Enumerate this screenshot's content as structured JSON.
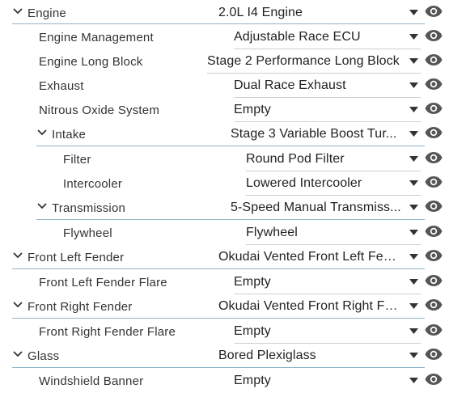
{
  "rows": [
    {
      "label": "Engine",
      "value": "2.0L I4 Engine",
      "expandable": true
    },
    {
      "label": "Engine Management",
      "value": "Adjustable Race ECU",
      "expandable": false
    },
    {
      "label": "Engine Long Block",
      "value": "Stage 2 Performance Long Block",
      "expandable": false
    },
    {
      "label": "Exhaust",
      "value": "Dual Race Exhaust",
      "expandable": false
    },
    {
      "label": "Nitrous Oxide System",
      "value": "Empty",
      "expandable": false
    },
    {
      "label": "Intake",
      "value": "Stage 3 Variable Boost Tur...",
      "expandable": true
    },
    {
      "label": "Filter",
      "value": "Round Pod Filter",
      "expandable": false
    },
    {
      "label": "Intercooler",
      "value": "Lowered Intercooler",
      "expandable": false
    },
    {
      "label": "Transmission",
      "value": "5-Speed Manual Transmiss...",
      "expandable": true
    },
    {
      "label": "Flywheel",
      "value": "Flywheel",
      "expandable": false
    },
    {
      "label": "Front Left Fender",
      "value": "Okudai Vented Front Left Fen...",
      "expandable": true
    },
    {
      "label": "Front Left Fender Flare",
      "value": "Empty",
      "expandable": false
    },
    {
      "label": "Front Right Fender",
      "value": "Okudai Vented Front Right Fe...",
      "expandable": true
    },
    {
      "label": "Front Right Fender Flare",
      "value": "Empty",
      "expandable": false
    },
    {
      "label": "Glass",
      "value": "Bored Plexiglass",
      "expandable": true
    },
    {
      "label": "Windshield Banner",
      "value": "Empty",
      "expandable": false
    }
  ],
  "icons": {
    "expand": "chevron-down-icon",
    "dropdown": "caret-down-icon",
    "visibility": "eye-icon"
  },
  "colors": {
    "text": "#333333",
    "icon": "#555555",
    "parent_rule": "#8fb3c9",
    "child_rule": "#cfcfcf"
  }
}
